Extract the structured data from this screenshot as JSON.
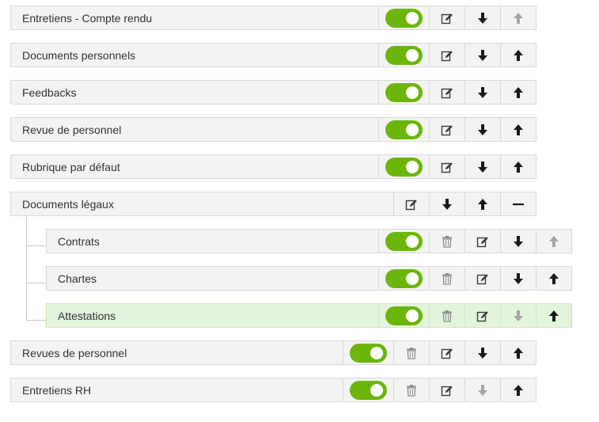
{
  "rows": [
    {
      "label": "Entretiens - Compte rendu",
      "enabled": true,
      "up_enabled": false,
      "down_enabled": true
    },
    {
      "label": "Documents personnels",
      "enabled": true,
      "up_enabled": true,
      "down_enabled": true
    },
    {
      "label": "Feedbacks",
      "enabled": true,
      "up_enabled": true,
      "down_enabled": true
    },
    {
      "label": "Revue de personnel",
      "enabled": true,
      "up_enabled": true,
      "down_enabled": true
    },
    {
      "label": "Rubrique par défaut",
      "enabled": true,
      "up_enabled": true,
      "down_enabled": true
    },
    {
      "label": "Documents légaux",
      "expanded": true,
      "up_enabled": true,
      "down_enabled": true
    },
    {
      "label": "Contrats",
      "enabled": true,
      "up_enabled": false,
      "down_enabled": true
    },
    {
      "label": "Chartes",
      "enabled": true,
      "up_enabled": true,
      "down_enabled": true
    },
    {
      "label": "Attestations",
      "enabled": true,
      "up_enabled": true,
      "down_enabled": false,
      "highlighted": true
    },
    {
      "label": "Revues de personnel",
      "enabled": true,
      "up_enabled": true,
      "down_enabled": true
    },
    {
      "label": "Entretiens RH",
      "enabled": true,
      "up_enabled": true,
      "down_enabled": false
    }
  ],
  "colors": {
    "toggle_on": "#6cb60c",
    "highlight": "#e3f4dd",
    "arrow": "#1a1a1a",
    "arrow_disabled": "#a5a5a5"
  },
  "icons": {
    "edit": "edit-icon",
    "delete": "trash-icon",
    "down": "arrow-down-icon",
    "up": "arrow-up-icon",
    "collapse": "minus-icon"
  }
}
